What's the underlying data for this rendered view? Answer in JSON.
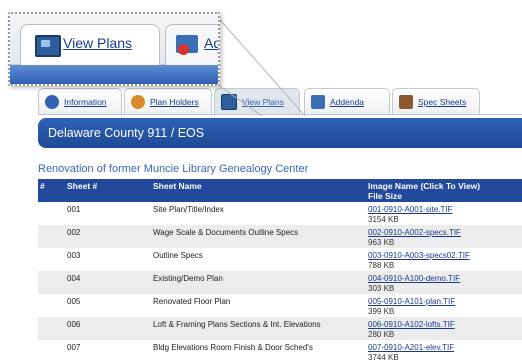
{
  "zoom": {
    "tabs": [
      {
        "label": "View Plans",
        "icon": "monitor-icon"
      },
      {
        "label": "Add",
        "icon": "addenda-icon"
      }
    ]
  },
  "tabs": [
    {
      "label": "Information",
      "icon": "information-icon"
    },
    {
      "label": "Plan Holders",
      "icon": "plan-holders-icon"
    },
    {
      "label": "View Plans",
      "icon": "monitor-icon"
    },
    {
      "label": "Addenda",
      "icon": "addenda-icon"
    },
    {
      "label": "Spec Sheets",
      "icon": "spec-sheets-icon"
    }
  ],
  "header": {
    "title": "Delaware County 911 / EOS"
  },
  "project": {
    "name": "Renovation of former Muncie Library Genealogy Center"
  },
  "table": {
    "columns": {
      "num": "#",
      "sheet": "Sheet #",
      "name": "Sheet Name",
      "image": "Image Name (Click To View)",
      "size": "File Size"
    },
    "rows": [
      {
        "sheet": "001",
        "name": "Site Plan/Title/Index",
        "file": "001-0910-A001-site.TIF",
        "size": "3154 KB"
      },
      {
        "sheet": "002",
        "name": "Wage Scale & Documents Outline Specs",
        "file": "002-0910-A002-specs.TIF",
        "size": "963 KB"
      },
      {
        "sheet": "003",
        "name": "Outline Specs",
        "file": "003-0910-A003-specs02.TIF",
        "size": "788 KB"
      },
      {
        "sheet": "004",
        "name": "Existing/Demo Plan",
        "file": "004-0910-A100-demo.TIF",
        "size": "303 KB"
      },
      {
        "sheet": "005",
        "name": "Renovated Floor Plan",
        "file": "005-0910-A101-plan.TIF",
        "size": "399 KB"
      },
      {
        "sheet": "006",
        "name": "Loft & Framing Plans Sections & Int. Elevations",
        "file": "006-0910-A102-lofts.TIF",
        "size": "280 KB"
      },
      {
        "sheet": "007",
        "name": "Bldg Elevations Room Finish & Door Sched's",
        "file": "007-0910-A201-elev.TIF",
        "size": "3744 KB"
      }
    ]
  },
  "colors": {
    "accent": "#22499b",
    "link": "#1b3b8f",
    "project_text": "#3c68b5",
    "alt_row": "#ececec"
  }
}
